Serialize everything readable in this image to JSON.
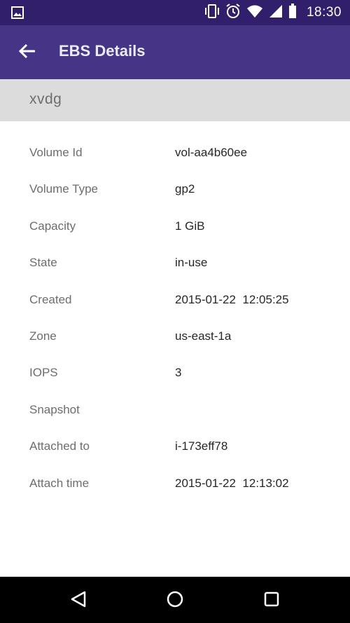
{
  "status_bar": {
    "time": "18:30",
    "icons": [
      "image-notification-icon",
      "vibrate-icon",
      "alarm-icon",
      "wifi-icon",
      "cell-signal-icon",
      "battery-icon"
    ]
  },
  "app_bar": {
    "title": "EBS Details",
    "back_icon": "arrow-left-icon"
  },
  "volume": {
    "device": "xvdg"
  },
  "details": {
    "rows": [
      {
        "label": "Volume Id",
        "value": "vol-aa4b60ee"
      },
      {
        "label": "Volume Type",
        "value": "gp2"
      },
      {
        "label": "Capacity",
        "value": "1 GiB"
      },
      {
        "label": "State",
        "value": "in-use"
      },
      {
        "label": "Created",
        "value": "2015-01-22  12:05:25"
      },
      {
        "label": "Zone",
        "value": "us-east-1a"
      },
      {
        "label": "IOPS",
        "value": "3"
      },
      {
        "label": "Snapshot",
        "value": ""
      },
      {
        "label": "Attached to",
        "value": "i-173eff78"
      },
      {
        "label": "Attach time",
        "value": "2015-01-22  12:13:02"
      }
    ]
  },
  "nav_bar": {
    "icons": [
      "back-triangle-icon",
      "home-circle-icon",
      "recents-square-icon"
    ]
  },
  "colors": {
    "status_bar": "#311f6b",
    "app_bar": "#463587",
    "sub_header": "#dcdcdc"
  }
}
